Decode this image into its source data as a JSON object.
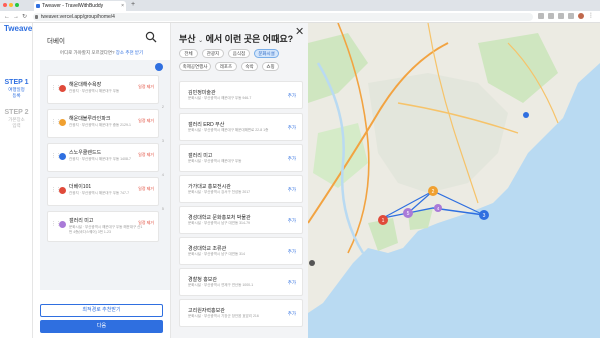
{
  "browser": {
    "tab_title": "Tweaver - TravelWithBuddy",
    "url": "tweaver.vercel.app/group/home/4",
    "new_tab_label": "+"
  },
  "app": {
    "logo": "Tweaver"
  },
  "steps": [
    {
      "num": "STEP 1",
      "label1": "여행일정",
      "label2": "등록"
    },
    {
      "num": "STEP 2",
      "label1": "가본장소",
      "label2": "입력"
    }
  ],
  "left_panel": {
    "title": "더베이",
    "hint_prefix": "어디로 가야할지 모르겠다면? ",
    "hint_link": "장소 추천 받기",
    "items": [
      {
        "name": "해운대해수욕장",
        "sub": "관광지 · 부산광역시 해운대구 우동",
        "remove": "일정 제거",
        "color": "#e04a3a",
        "idx": "1"
      },
      {
        "name": "해운대블루라인파크",
        "sub": "관광지 · 부산광역시 해운대구 중동 2129-1",
        "remove": "일정 제거",
        "color": "#f0a030",
        "idx": "2"
      },
      {
        "name": "스노우쿨렌드드",
        "sub": "관광지 · 부산광역시 해운대구 우동 1408-7",
        "remove": "일정 제거",
        "color": "#2f6fe0",
        "idx": "3"
      },
      {
        "name": "더베이101",
        "sub": "관광지 · 부산광역시 해운대구 우동 747-7",
        "remove": "일정 제거",
        "color": "#e04a3a",
        "idx": "4"
      },
      {
        "name": "갤러리 미고",
        "sub": "문화시설 · 부산광역시 해운대구 우동 해운대구 산1번 4층(바다스퀘어) 3번 1-23",
        "remove": "일정 제거",
        "color": "#a97ad8",
        "idx": "5"
      }
    ],
    "btn_recommend": "최적경로 추천받기",
    "btn_next": "다음"
  },
  "middle_panel": {
    "region": "부산",
    "chevron": "⌄",
    "suffix": "에서 이런 곳은 어때요?",
    "close": "✕",
    "chips": [
      "전체",
      "관광지",
      "음식점",
      "문화시설",
      "축제공연행사",
      "레포츠",
      "숙박",
      "쇼핑"
    ],
    "selected_chip": 3,
    "cards": [
      {
        "name": "김민정미술관",
        "sub": "문화시설 · 부산광역시 해운대구 우동 946-7",
        "add": "추가"
      },
      {
        "name": "갤러리 ERD 부산",
        "sub": "문화시설 · 부산광역시 해운대구 해운대해변로 22-8 1층",
        "add": "추가"
      },
      {
        "name": "갤러리 미고",
        "sub": "문화시설 · 부산광역시 해운대구 우동",
        "add": "추가"
      },
      {
        "name": "가가대교 홍보전시관",
        "sub": "문화시설 · 부산광역시 강서구 천성동 2017",
        "add": "추가"
      },
      {
        "name": "경성대학교 문화홍보처 박물관",
        "sub": "문화시설 · 부산광역시 남구 대연동 314-79",
        "add": "추가"
      },
      {
        "name": "경성대학교 조류관",
        "sub": "문화시설 · 부산광역시 남구 대연동 314",
        "add": "추가"
      },
      {
        "name": "경찰청 홍보관",
        "sub": "문화시설 · 부산광역시 연제구 연산동 1000-1",
        "add": "추가"
      },
      {
        "name": "고리원자력홍보관",
        "sub": "문화시설 · 부산광역시 기장군 장안읍 효암리 216",
        "add": "추가"
      }
    ]
  },
  "map": {
    "route_color": "#2f6fe0",
    "markers": [
      "1",
      "2",
      "3",
      "4",
      "5"
    ]
  }
}
